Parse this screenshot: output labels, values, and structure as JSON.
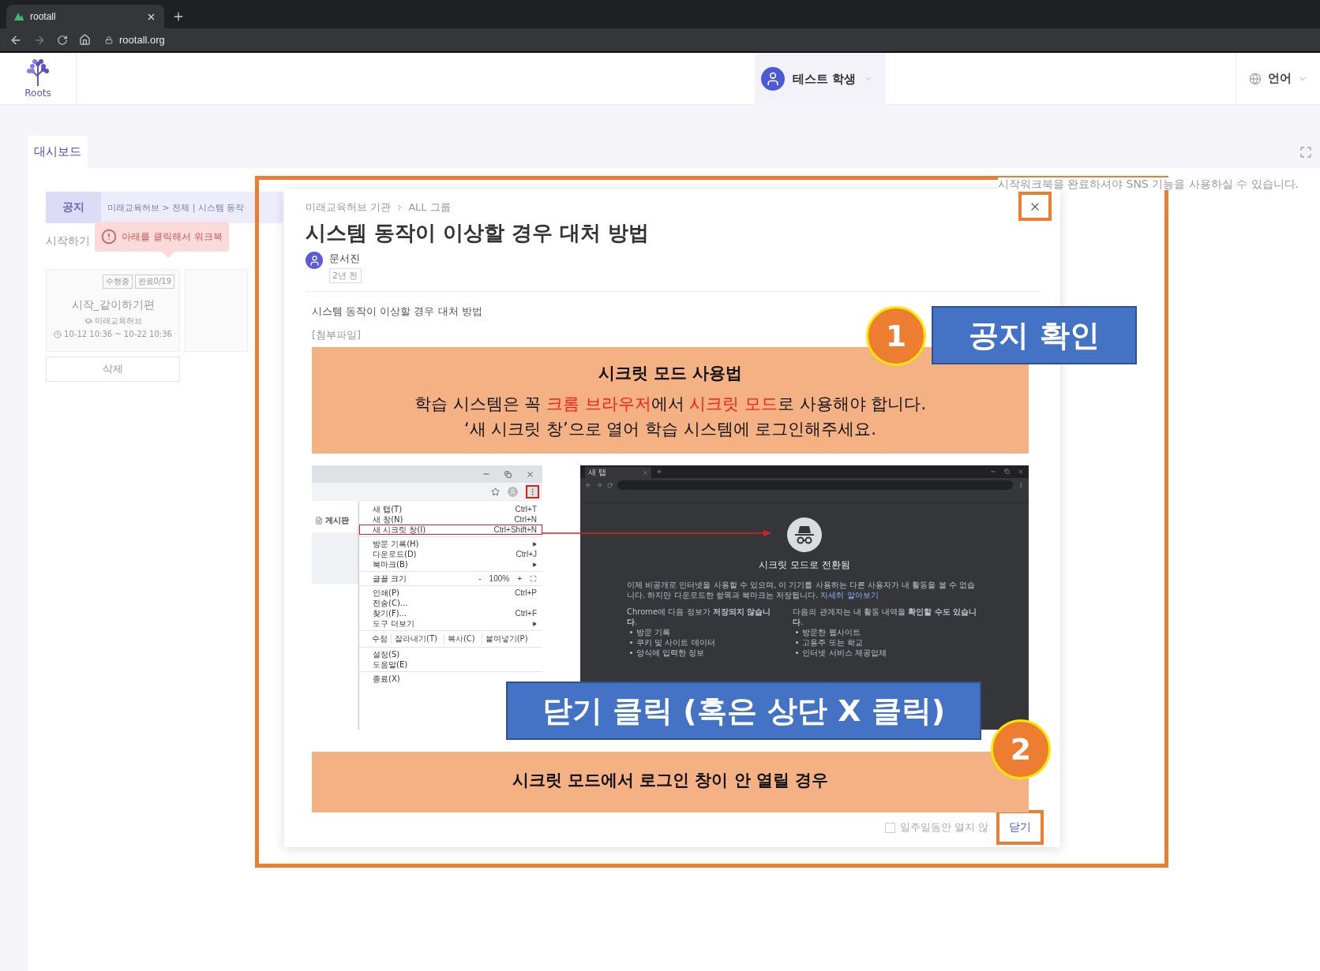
{
  "browser": {
    "tab_title": "rootall",
    "url": "rootall.org"
  },
  "header": {
    "logo_text": "Roots",
    "user_name": "테스트 학생",
    "language": "언어"
  },
  "tabs": [
    {
      "label": "대시보드",
      "selected": true
    }
  ],
  "background": {
    "notice_label": "공지",
    "notice_text": "미래교육허브 > 전체 | 시스템 동작",
    "tooltip": "아래를 클릭해서 워크북",
    "section_title": "시작하기",
    "cards": [
      {
        "badges": [
          "수행중",
          "완료0/19"
        ],
        "title": "시작_같이하기편",
        "org": "미래교육허브",
        "period": "10-12 10:36 ~ 10-22 10:36"
      }
    ],
    "delete_button": "삭제",
    "sns_notice": "시작워크북을 완료하셔야 SNS 기능을 사용하실 수 있습니다."
  },
  "modal": {
    "breadcrumb": [
      "미래교육허브 기관",
      "ALL 그룹"
    ],
    "title": "시스템 동작이 이상할 경우 대처 방법",
    "author": "문서진",
    "time": "2년 전",
    "body": "시스템 동작이 이상할 경우 대처 방법",
    "attachment_label": "[첨부파일]",
    "guide": {
      "heading": "시크릿 모드 사용법",
      "lines": [
        [
          {
            "text": "학습 시스템은 꼭 ",
            "highlight": false
          },
          {
            "text": "크롬 브라우저",
            "highlight": true
          },
          {
            "text": "에서 ",
            "highlight": false
          },
          {
            "text": "시크릿 모드",
            "highlight": true
          },
          {
            "text": "로 사용해야 합니다.",
            "highlight": false
          }
        ],
        [
          {
            "text": "‘새 시크릿 창’으로 열어 학습 시스템에 로그인해주세요.",
            "highlight": false
          }
        ]
      ],
      "menu": {
        "page_label": "게시판",
        "more_button_highlighted": true,
        "items": [
          {
            "kind": "item",
            "label": "새 탭(T)",
            "shortcut": "Ctrl+T",
            "submenu": false,
            "highlighted": false
          },
          {
            "kind": "item",
            "label": "새 창(N)",
            "shortcut": "Ctrl+N",
            "submenu": false,
            "highlighted": false
          },
          {
            "kind": "item",
            "label": "새 시크릿 창(I)",
            "shortcut": "Ctrl+Shift+N",
            "submenu": false,
            "highlighted": true
          },
          {
            "kind": "divider"
          },
          {
            "kind": "item",
            "label": "방문 기록(H)",
            "submenu": true,
            "highlighted": false
          },
          {
            "kind": "item",
            "label": "다운로드(D)",
            "shortcut": "Ctrl+J",
            "submenu": false,
            "highlighted": false
          },
          {
            "kind": "item",
            "label": "북마크(B)",
            "submenu": true,
            "highlighted": false
          },
          {
            "kind": "divider"
          },
          {
            "kind": "zoom",
            "label": "글꼴 크기",
            "minus": "-",
            "value": "100%",
            "plus": "+"
          },
          {
            "kind": "divider"
          },
          {
            "kind": "item",
            "label": "인쇄(P)",
            "shortcut": "Ctrl+P",
            "submenu": false,
            "highlighted": false
          },
          {
            "kind": "item",
            "label": "전송(C)...",
            "submenu": false,
            "highlighted": false
          },
          {
            "kind": "item",
            "label": "찾기(F)...",
            "shortcut": "Ctrl+F",
            "submenu": false,
            "highlighted": false
          },
          {
            "kind": "item",
            "label": "도구 더보기",
            "submenu": true,
            "highlighted": false
          },
          {
            "kind": "divider"
          },
          {
            "kind": "edit",
            "label": "수정",
            "actions": [
              "잘라내기(T)",
              "복사(C)",
              "붙여넣기(P)"
            ]
          },
          {
            "kind": "divider"
          },
          {
            "kind": "item",
            "label": "설정(S)",
            "submenu": false,
            "highlighted": false
          },
          {
            "kind": "item",
            "label": "도움말(E)",
            "submenu": false,
            "highlighted": false
          },
          {
            "kind": "divider"
          },
          {
            "kind": "item",
            "label": "종료(X)",
            "submenu": false,
            "highlighted": false
          }
        ]
      },
      "incognito": {
        "tab_title": "새 탭",
        "heading": "시크릿 모드로 전환됨",
        "intro": "이제 비공개로 인터넷을 사용할 수 있으며, 이 기기를 사용하는 다른 사용자가 내 활동을 볼 수 없습니다. 하지만 다운로드한 항목과 북마크는 저장됩니다.",
        "learn_more": "자세히 알아보기",
        "columns": [
          {
            "title": "Chrome에 다음 정보가 **저장되지 않습니다**.",
            "items": [
              "방문 기록",
              "쿠키 및 사이트 데이터",
              "양식에 입력한 정보"
            ]
          },
          {
            "title": "다음의 관계자는 내 활동 내역을 **확인할 수도 있습니다**.",
            "items": [
              "방문한 웹사이트",
              "고용주 또는 학교",
              "인터넷 서비스 제공업체"
            ]
          }
        ]
      },
      "footer_heading": "시크릿 모드에서 로그인 창이 안 열릴 경우"
    },
    "dont_show": {
      "label": "일주일동안 열지 않",
      "checked": false
    },
    "close_button": "닫기"
  },
  "annotations": [
    {
      "kind": "step",
      "number": "1",
      "label": "공지 확인"
    },
    {
      "kind": "step",
      "number": "2",
      "label": "닫기 클릭 (혹은 상단 X 클릭)"
    }
  ]
}
